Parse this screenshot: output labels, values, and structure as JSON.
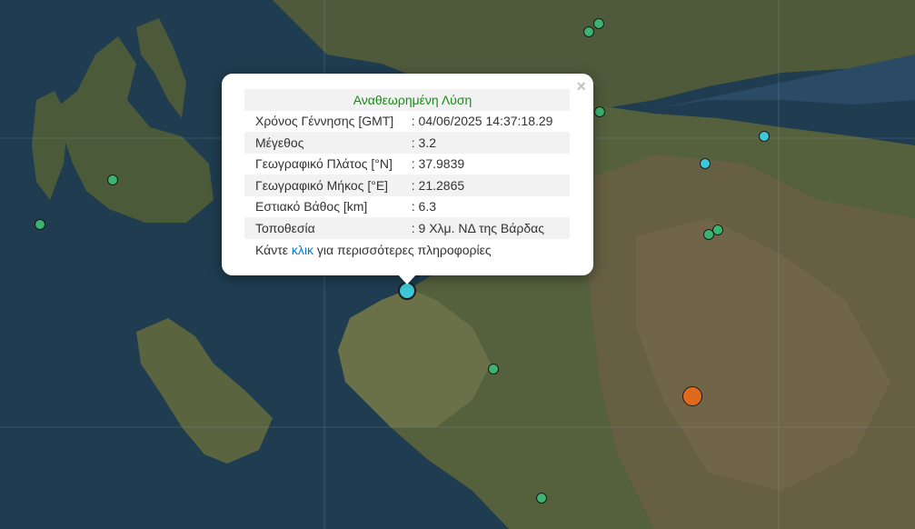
{
  "popup": {
    "title": "Αναθεωρημένη Λύση",
    "close_glyph": "×",
    "rows": [
      {
        "label": "Χρόνος Γέννησης [GMT]",
        "value": ": 04/06/2025 14:37:18.29"
      },
      {
        "label": "Μέγεθος",
        "value": ": 3.2"
      },
      {
        "label": "Γεωγραφικό Πλάτος [°N]",
        "value": ": 37.9839"
      },
      {
        "label": "Γεωγραφικό Μήκος [°E]",
        "value": ": 21.2865"
      },
      {
        "label": "Εστιακό Βάθος [km]",
        "value": ": 6.3"
      },
      {
        "label": "Τοποθεσία",
        "value": ": 9 Χλμ. ΝΔ της Βάρδας"
      }
    ],
    "more_prefix": "Κάντε ",
    "more_link": "κλικ",
    "more_suffix": " για περισσότερες πληροφορίες"
  },
  "marker_colors": {
    "green": "#3cb371",
    "cyan": "#3cc8d8",
    "orange": "#e06a1c"
  },
  "map_colors": {
    "sea": "#1d3a4e",
    "land": "#4d5a3a",
    "mountain": "#6b5e44",
    "grid": "#8fa3b3"
  }
}
